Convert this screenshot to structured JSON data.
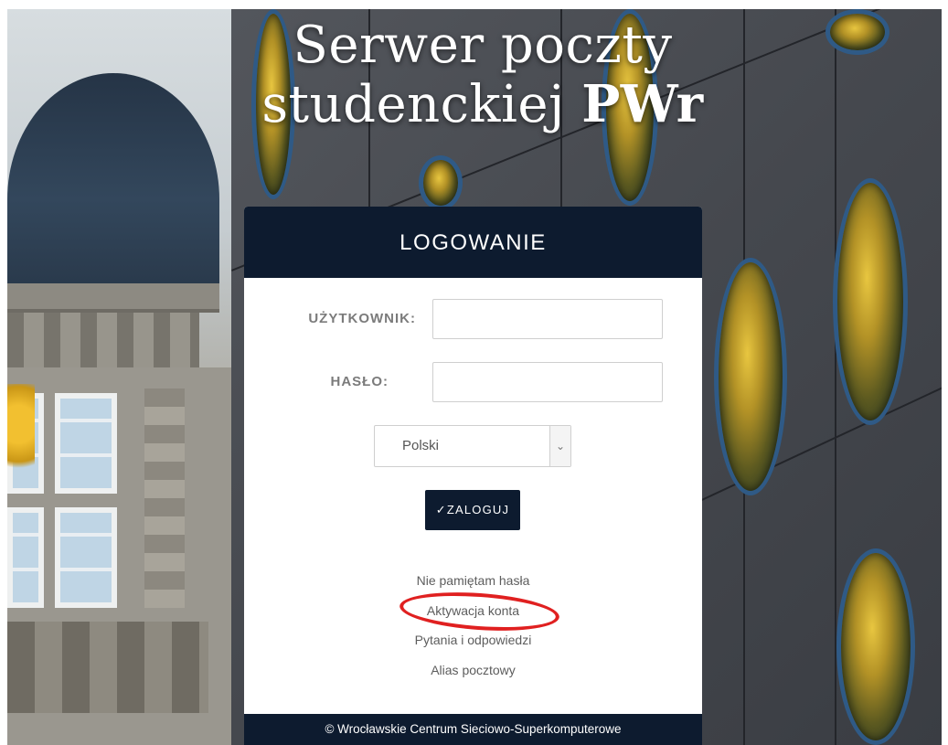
{
  "header": {
    "title_line1": "Serwer poczty",
    "title_line2_regular": "studenckiej ",
    "title_line2_bold": "PWr"
  },
  "login_card": {
    "heading": "LOGOWANIE",
    "username_label": "UŻYTKOWNIK:",
    "username_value": "",
    "password_label": "HASŁO:",
    "password_value": "",
    "language_selected": "Polski",
    "login_button_check": "✓",
    "login_button_label": "ZALOGUJ",
    "links": {
      "forgot_password": "Nie pamiętam hasła",
      "account_activation": "Aktywacja konta",
      "faq": "Pytania i odpowiedzi",
      "mail_alias": "Alias pocztowy"
    },
    "footer": "© Wrocławskie Centrum Sieciowo-Superkomputerowe"
  },
  "icons": {
    "select_arrow": "chevron-down-icon"
  },
  "colors": {
    "card_header": "#0d1b2f",
    "highlight_ring": "#e02020"
  }
}
